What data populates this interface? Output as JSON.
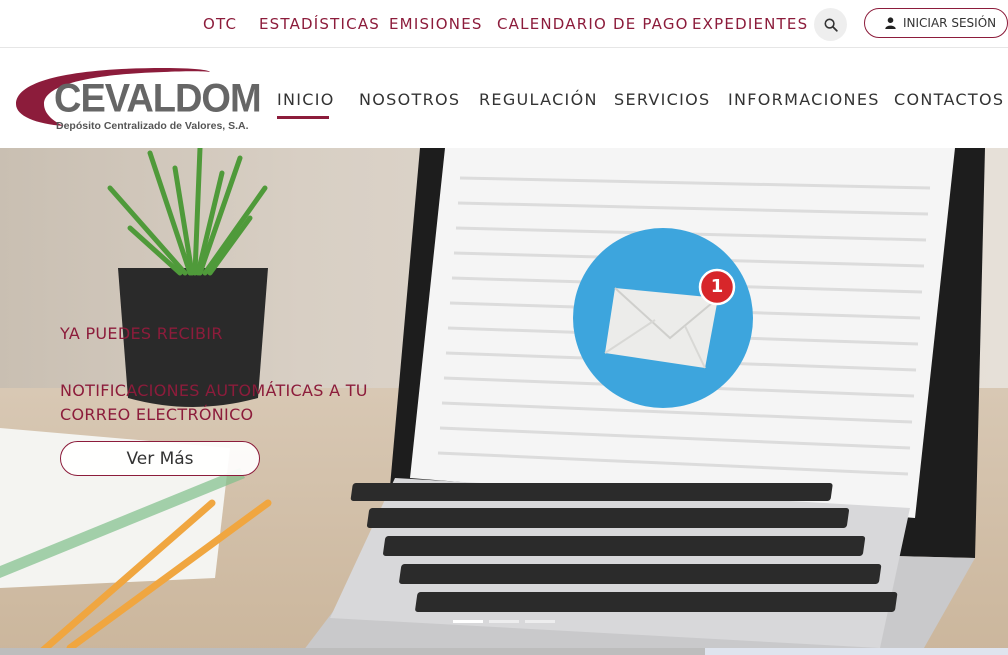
{
  "topbar": {
    "links": [
      "OTC",
      "ESTADÍSTICAS",
      "EMISIONES",
      "CALENDARIO DE PAGO",
      "EXPEDIENTES"
    ],
    "search_icon": "search-icon",
    "login_label": "INICIAR SESIÓN",
    "login_icon": "user-icon"
  },
  "brand": {
    "name": "CEVALDOM",
    "tagline": "Depósito Centralizado de Valores, S.A."
  },
  "nav": {
    "items": [
      "INICIO",
      "NOSOTROS",
      "REGULACIÓN",
      "SERVICIOS",
      "INFORMACIONES",
      "CONTACTOS"
    ],
    "active": "INICIO"
  },
  "hero": {
    "line1": "YA PUEDES RECIBIR",
    "line2": "NOTIFICACIONES AUTOMÁTICAS A TU CORREO ELECTRÓNICO",
    "cta_label": "Ver Más",
    "badge_count": "1",
    "slides": 3,
    "active_slide": 1
  },
  "colors": {
    "accent": "#8c1c3b",
    "mail_circle": "#3da5dd",
    "badge": "#d7262a"
  }
}
